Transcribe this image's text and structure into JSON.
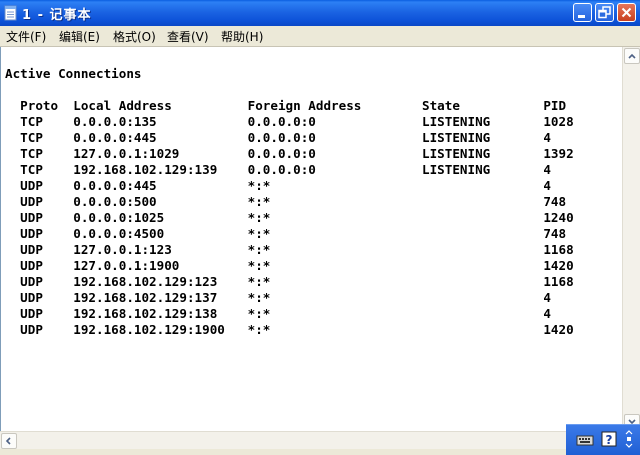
{
  "window": {
    "title": "1 - 记事本"
  },
  "menu": {
    "items": [
      {
        "label": "文件(F)"
      },
      {
        "label": "编辑(E)"
      },
      {
        "label": "格式(O)"
      },
      {
        "label": "查看(V)"
      },
      {
        "label": "帮助(H)"
      }
    ]
  },
  "document": {
    "heading": "Active Connections",
    "columns": [
      "Proto",
      "Local Address",
      "Foreign Address",
      "State",
      "PID"
    ],
    "rows": [
      [
        "TCP",
        "0.0.0.0:135",
        "0.0.0.0:0",
        "LISTENING",
        "1028"
      ],
      [
        "TCP",
        "0.0.0.0:445",
        "0.0.0.0:0",
        "LISTENING",
        "4"
      ],
      [
        "TCP",
        "127.0.0.1:1029",
        "0.0.0.0:0",
        "LISTENING",
        "1392"
      ],
      [
        "TCP",
        "192.168.102.129:139",
        "0.0.0.0:0",
        "LISTENING",
        "4"
      ],
      [
        "UDP",
        "0.0.0.0:445",
        "*:*",
        "",
        "4"
      ],
      [
        "UDP",
        "0.0.0.0:500",
        "*:*",
        "",
        "748"
      ],
      [
        "UDP",
        "0.0.0.0:1025",
        "*:*",
        "",
        "1240"
      ],
      [
        "UDP",
        "0.0.0.0:4500",
        "*:*",
        "",
        "748"
      ],
      [
        "UDP",
        "127.0.0.1:123",
        "*:*",
        "",
        "1168"
      ],
      [
        "UDP",
        "127.0.0.1:1900",
        "*:*",
        "",
        "1420"
      ],
      [
        "UDP",
        "192.168.102.129:123",
        "*:*",
        "",
        "1168"
      ],
      [
        "UDP",
        "192.168.102.129:137",
        "*:*",
        "",
        "4"
      ],
      [
        "UDP",
        "192.168.102.129:138",
        "*:*",
        "",
        "4"
      ],
      [
        "UDP",
        "192.168.102.129:1900",
        "*:*",
        "",
        "1420"
      ]
    ]
  },
  "icons": {
    "app": "notepad-icon",
    "minimize": "minimize-icon",
    "maximize": "maximize-icon",
    "close": "close-icon",
    "keyboard": "keyboard-icon",
    "help": "help-icon",
    "options": "options-icon"
  },
  "colors": {
    "titlebar": "#1b64e3",
    "close_button": "#c8401f",
    "window_frame": "#ece9d8",
    "editor_bg": "#ffffff"
  }
}
